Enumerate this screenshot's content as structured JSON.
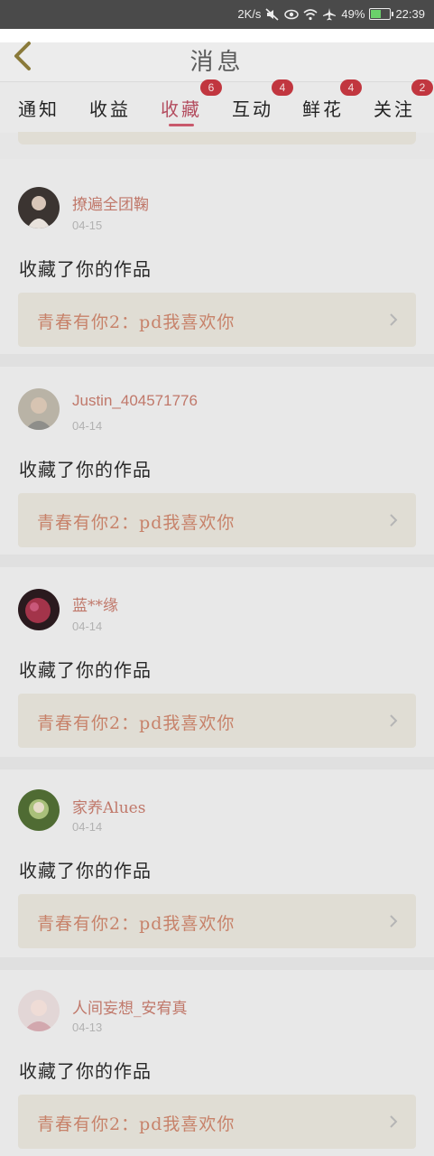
{
  "status_bar": {
    "speed": "2K/s",
    "battery": "49%",
    "battery_level": 0.49,
    "time": "22:39"
  },
  "header": {
    "title": "消息"
  },
  "tabs": [
    {
      "label": "通知",
      "badge": ""
    },
    {
      "label": "收益",
      "badge": ""
    },
    {
      "label": "收藏",
      "badge": "6",
      "active": true
    },
    {
      "label": "互动",
      "badge": "4"
    },
    {
      "label": "鲜花",
      "badge": "4"
    },
    {
      "label": "关注",
      "badge": "2"
    }
  ],
  "items": [
    {
      "username": "撩遍全团鞠",
      "date": "04-15",
      "action": "收藏了你的作品",
      "work": "青春有你2：pd我喜欢你",
      "avatar_color": "#6d5a4a"
    },
    {
      "username": "Justin_404571776",
      "date": "04-14",
      "action": "收藏了你的作品",
      "work": "青春有你2：pd我喜欢你",
      "avatar_color": "#a7a090"
    },
    {
      "username": "蓝**缘",
      "date": "04-14",
      "action": "收藏了你的作品",
      "work": "青春有你2：pd我喜欢你",
      "avatar_color": "#a3344a"
    },
    {
      "username": "家养Alues",
      "date": "04-14",
      "action": "收藏了你的作品",
      "work": "青春有你2：pd我喜欢你",
      "avatar_color": "#5d7a3e"
    },
    {
      "username": "人间妄想_安宥真",
      "date": "04-13",
      "action": "收藏了你的作品",
      "work": "青春有你2：pd我喜欢你",
      "avatar_color": "#cfb7b7"
    }
  ],
  "colors": {
    "accent": "#c9596c",
    "badge": "#c1363f",
    "work_title": "#c7826a"
  }
}
